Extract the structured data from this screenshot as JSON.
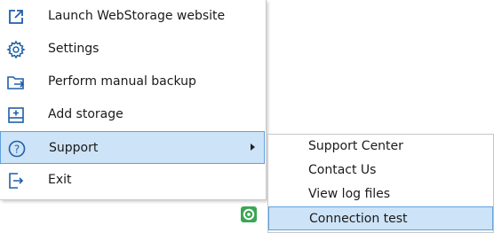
{
  "menu": {
    "items": [
      {
        "label": "Launch WebStorage website",
        "icon": "external-link-icon"
      },
      {
        "label": "Settings",
        "icon": "gear-icon"
      },
      {
        "label": "Perform manual backup",
        "icon": "folder-arrow-icon"
      },
      {
        "label": "Add storage",
        "icon": "add-storage-icon"
      },
      {
        "label": "Support",
        "icon": "help-circle-icon"
      },
      {
        "label": "Exit",
        "icon": "exit-icon"
      }
    ]
  },
  "submenu": {
    "items": [
      {
        "label": "Support Center"
      },
      {
        "label": "Contact Us"
      },
      {
        "label": "View log files"
      },
      {
        "label": "Connection test"
      }
    ]
  },
  "colors": {
    "accent": "#1f5fa8",
    "selection_bg": "#cde3f7",
    "selection_border": "#5fa1de",
    "tray_green": "#3aa655"
  }
}
